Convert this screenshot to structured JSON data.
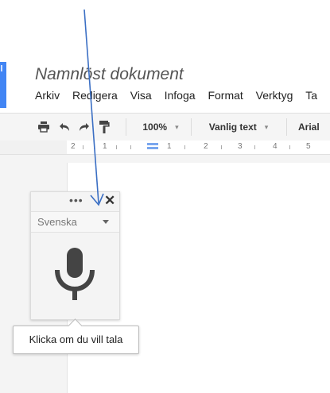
{
  "caption": {
    "partial_text": "                                         "
  },
  "document": {
    "title": "Namnlöst dokument"
  },
  "menu": {
    "items": [
      "Arkiv",
      "Redigera",
      "Visa",
      "Infoga",
      "Format",
      "Verktyg",
      "Ta"
    ]
  },
  "toolbar": {
    "zoom": "100%",
    "style": "Vanlig text",
    "font": "Arial",
    "icons": [
      "print-icon",
      "undo-icon",
      "redo-icon",
      "paint-format-icon"
    ]
  },
  "ruler": {
    "labels": [
      "2",
      "1",
      "1",
      "2",
      "3",
      "4",
      "5"
    ]
  },
  "voice_typing": {
    "menu_glyph": "•••",
    "close_glyph": "✕",
    "language": "Svenska",
    "mic_icon": "microphone-icon",
    "tooltip": "Klicka om du vill tala"
  },
  "colors": {
    "accent_blue": "#4285f4",
    "annotation_arrow": "#3b6fc4",
    "mic": "#444444"
  }
}
